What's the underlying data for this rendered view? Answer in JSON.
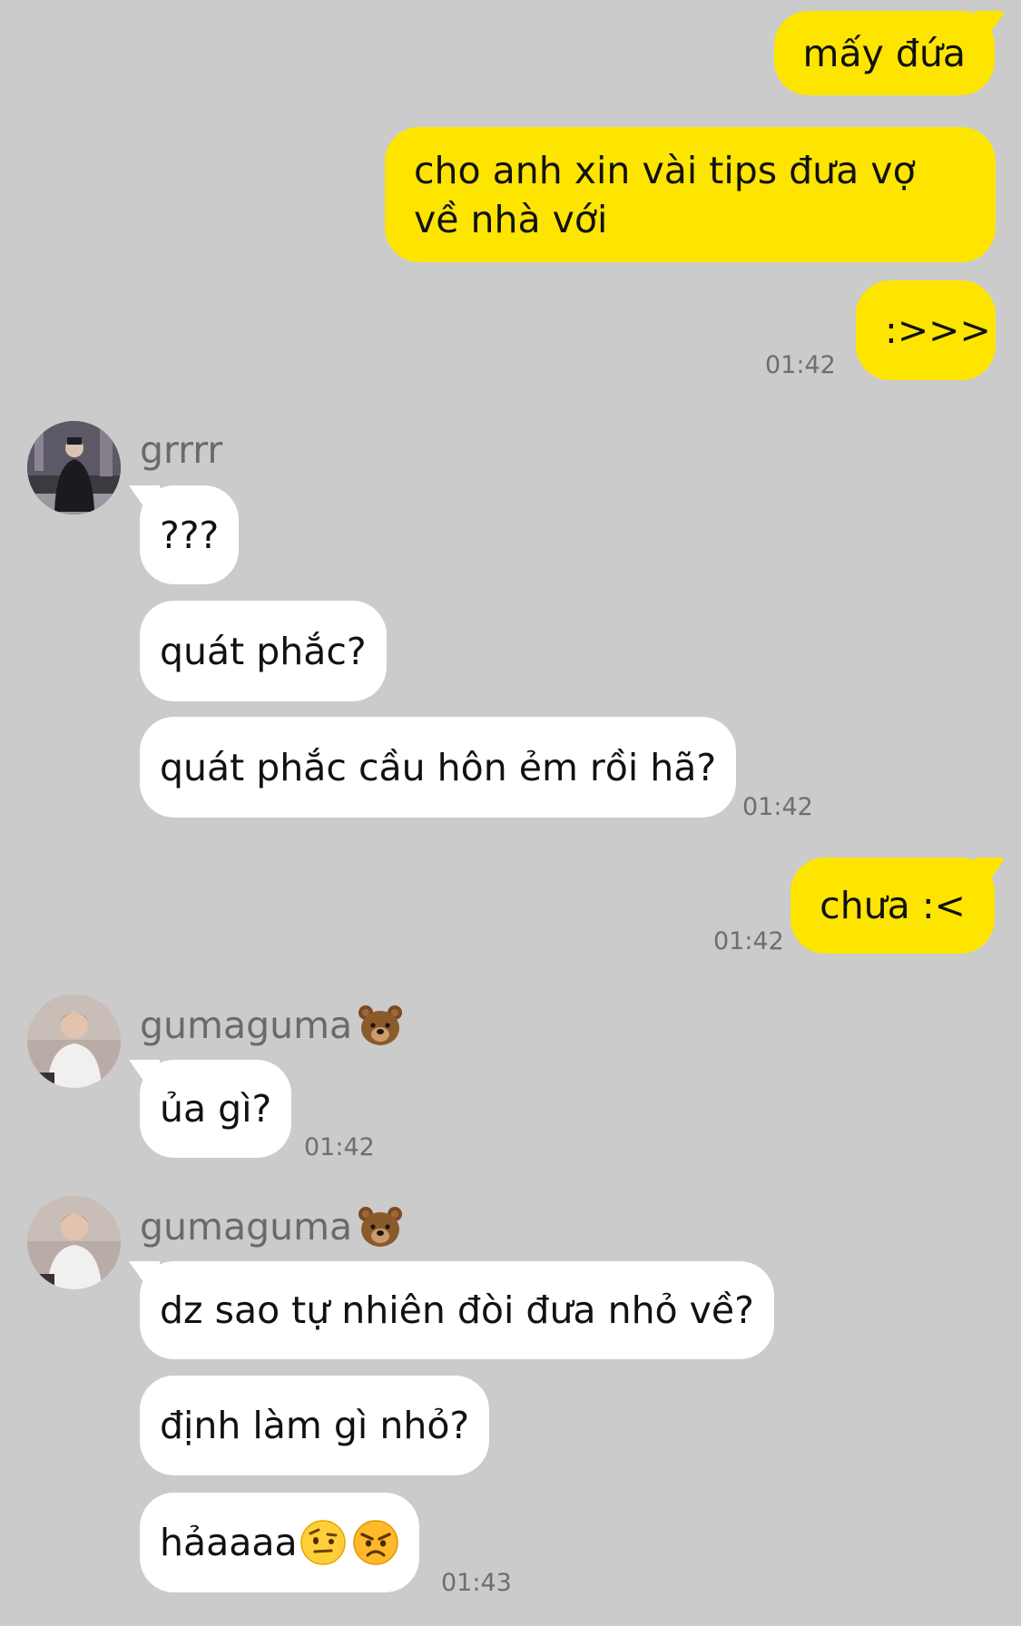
{
  "messages": {
    "m1": "mấy đứa",
    "m2": "cho anh xin vài tips đưa vợ về nhà với",
    "m3": ":>>>",
    "t1": "01:42",
    "grrrr_name": "grrrr",
    "g1": "???",
    "g2": "quát phắc?",
    "g3": "quát phắc cầu hôn ẻm rồi hã?",
    "t2": "01:42",
    "m4": "chưa :<",
    "t3": "01:42",
    "guma_name": "gumaguma",
    "u1": "ủa gì?",
    "t4": "01:42",
    "u2": "dz sao tự nhiên đòi đưa nhỏ về?",
    "u3": "định làm gì nhỏ?",
    "u4": "hảaaaa",
    "t5": "01:43"
  },
  "icons": {
    "bear": "bear-face-emoji",
    "raised_eyebrow": "face-with-raised-eyebrow-emoji",
    "angry": "angry-face-emoji"
  },
  "colors": {
    "background": "#cbcbcb",
    "outgoing_bubble": "#fee500",
    "incoming_bubble": "#ffffff"
  }
}
